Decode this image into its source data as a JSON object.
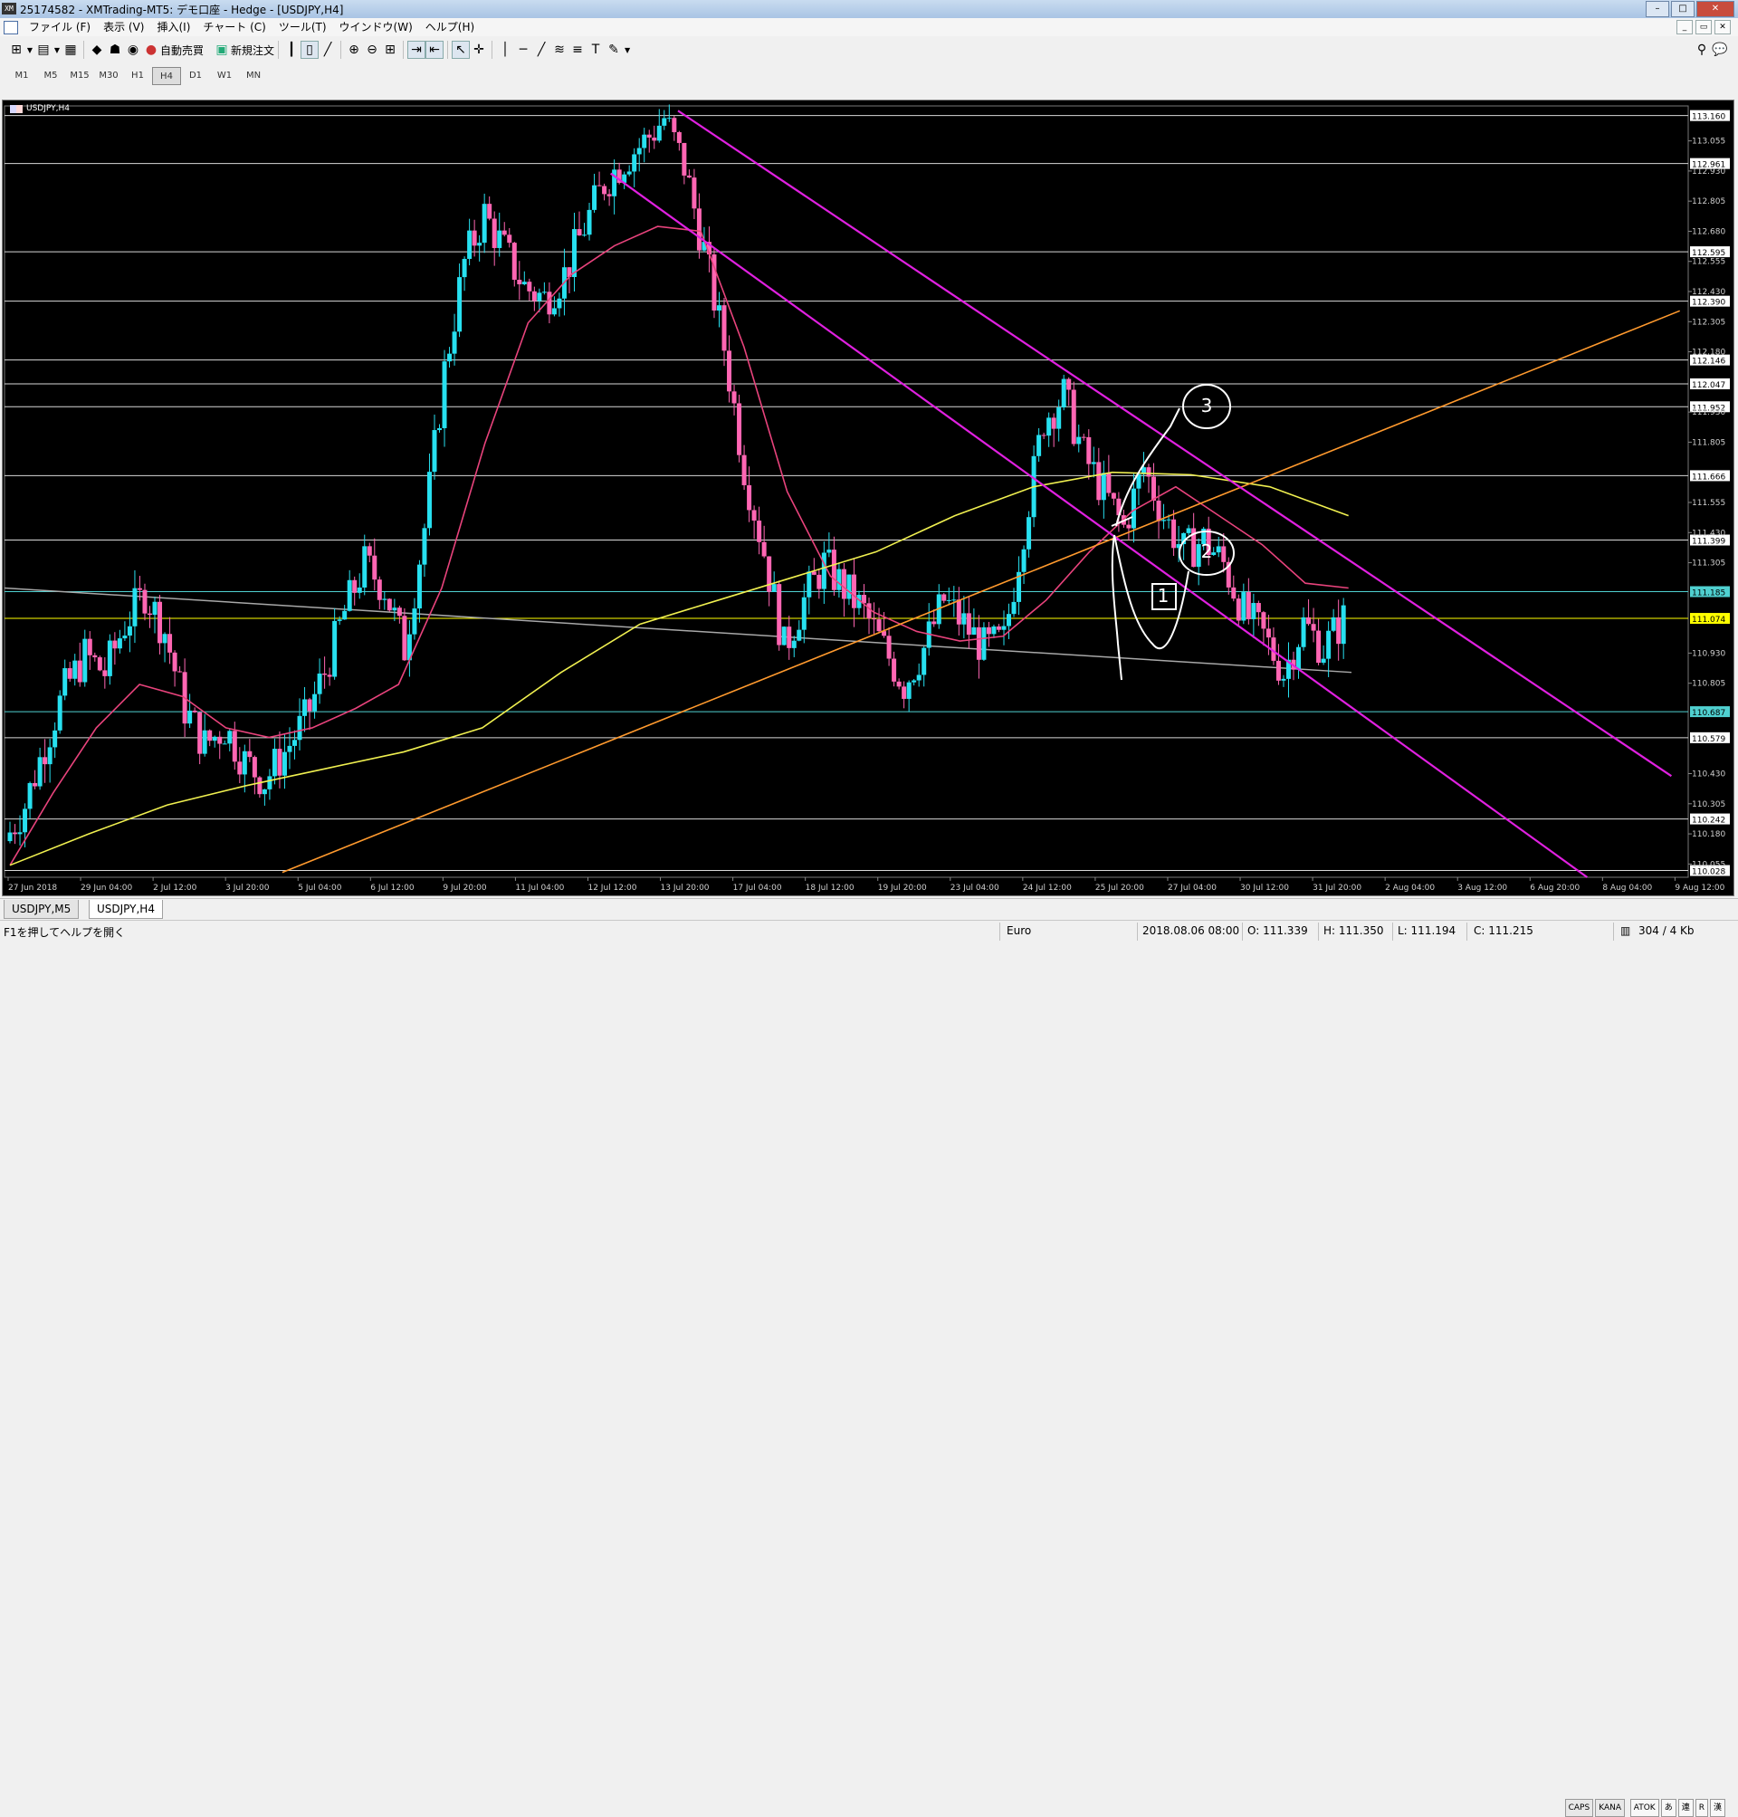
{
  "window": {
    "title": "25174582 - XMTrading-MT5: デモ口座 - Hedge - [USDJPY,H4]",
    "app_icon": "XM"
  },
  "menu": [
    "ファイル (F)",
    "表示 (V)",
    "挿入(I)",
    "チャート (C)",
    "ツール(T)",
    "ウインドウ(W)",
    "ヘルプ(H)"
  ],
  "toolbar": {
    "auto_trade_label": "自動売買",
    "new_order_label": "新規注文"
  },
  "timeframes": [
    "M1",
    "M5",
    "M15",
    "M30",
    "H1",
    "H4",
    "D1",
    "W1",
    "MN"
  ],
  "active_timeframe": "H4",
  "chart_label": "USDJPY,H4",
  "chart_data": {
    "type": "candlestick",
    "symbol": "USDJPY",
    "timeframe": "H4",
    "ylim": [
      110.0,
      113.2
    ],
    "y_ticks": [
      "113.055",
      "112.930",
      "112.805",
      "112.680",
      "112.555",
      "112.430",
      "112.305",
      "112.180",
      "111.930",
      "111.805",
      "111.555",
      "111.430",
      "111.305",
      "110.930",
      "110.805",
      "110.430",
      "110.305",
      "110.180",
      "110.055"
    ],
    "highlighted_levels": [
      {
        "value": 113.16,
        "label": "113.160"
      },
      {
        "value": 112.961,
        "label": "112.961"
      },
      {
        "value": 112.595,
        "label": "112.595"
      },
      {
        "value": 112.39,
        "label": "112.390"
      },
      {
        "value": 112.146,
        "label": "112.146"
      },
      {
        "value": 112.047,
        "label": "112.047"
      },
      {
        "value": 111.952,
        "label": "111.952"
      },
      {
        "value": 111.666,
        "label": "111.666"
      },
      {
        "value": 111.399,
        "label": "111.399"
      },
      {
        "value": 111.185,
        "label": "111.185",
        "color": "#4fd0d0"
      },
      {
        "value": 111.074,
        "label": "111.074",
        "color": "#ffff00"
      },
      {
        "value": 110.687,
        "label": "110.687",
        "color": "#4fd0d0"
      },
      {
        "value": 110.579,
        "label": "110.579"
      },
      {
        "value": 110.242,
        "label": "110.242"
      },
      {
        "value": 110.028,
        "label": "110.028"
      }
    ],
    "x_labels": [
      "27 Jun 2018",
      "29 Jun 04:00",
      "2 Jul 12:00",
      "3 Jul 20:00",
      "5 Jul 04:00",
      "6 Jul 12:00",
      "9 Jul 20:00",
      "11 Jul 04:00",
      "12 Jul 12:00",
      "13 Jul 20:00",
      "17 Jul 04:00",
      "18 Jul 12:00",
      "19 Jul 20:00",
      "23 Jul 04:00",
      "24 Jul 12:00",
      "25 Jul 20:00",
      "27 Jul 04:00",
      "30 Jul 12:00",
      "31 Jul 20:00",
      "2 Aug 04:00",
      "3 Aug 12:00",
      "6 Aug 20:00",
      "8 Aug 04:00",
      "9 Aug 12:00"
    ],
    "close_path": [
      110.15,
      110.3,
      110.55,
      110.78,
      110.92,
      110.85,
      111.05,
      111.18,
      111.02,
      110.7,
      110.55,
      110.62,
      110.48,
      110.4,
      110.52,
      110.65,
      110.85,
      111.1,
      111.3,
      111.2,
      110.95,
      111.45,
      112.1,
      112.55,
      112.75,
      112.6,
      112.45,
      112.4,
      112.5,
      112.7,
      112.88,
      112.98,
      113.05,
      113.15,
      112.95,
      112.6,
      112.2,
      111.7,
      111.35,
      110.95,
      111.15,
      111.3,
      111.2,
      111.1,
      110.95,
      110.8,
      110.95,
      111.15,
      111.05,
      110.95,
      110.98,
      111.45,
      111.9,
      112.0,
      111.75,
      111.6,
      111.45,
      111.7,
      111.5,
      111.35,
      111.4,
      111.3,
      111.1,
      111.0,
      110.85,
      111.05,
      110.95,
      111.07
    ],
    "ma_fast": [
      110.05,
      110.35,
      110.62,
      110.8,
      110.75,
      110.62,
      110.58,
      110.62,
      110.7,
      110.8,
      111.2,
      111.8,
      112.3,
      112.5,
      112.62,
      112.7,
      112.68,
      112.2,
      111.6,
      111.25,
      111.1,
      111.02,
      110.98,
      111.0,
      111.15,
      111.35,
      111.52,
      111.62,
      111.5,
      111.38,
      111.22,
      111.2
    ],
    "ma_slow": [
      110.05,
      110.18,
      110.3,
      110.38,
      110.45,
      110.52,
      110.62,
      110.85,
      111.05,
      111.15,
      111.25,
      111.35,
      111.5,
      111.62,
      111.68,
      111.67,
      111.62,
      111.5
    ],
    "trendline_orange": [
      [
        0.165,
        110.02
      ],
      [
        0.995,
        112.35
      ]
    ],
    "channel_upper": [
      [
        0.4,
        113.18
      ],
      [
        0.99,
        110.42
      ]
    ],
    "channel_lower": [
      [
        0.36,
        112.92
      ],
      [
        0.94,
        110.0
      ]
    ],
    "gray_line": [
      [
        0.0,
        111.2
      ],
      [
        0.8,
        110.85
      ]
    ],
    "annotations": [
      "1",
      "2",
      "3"
    ]
  },
  "tabs": [
    "USDJPY,M5",
    "USDJPY,H4"
  ],
  "active_tab": "USDJPY,H4",
  "status": {
    "help": "F1を押してヘルプを開く",
    "profile": "Euro",
    "datetime": "2018.08.06 08:00",
    "open": "O: 111.339",
    "high": "H: 111.350",
    "low": "L: 111.194",
    "close": "C: 111.215",
    "traffic": "304 / 4 Kb"
  },
  "ime": [
    "CAPS",
    "KANA",
    "ATOK",
    "あ",
    "連",
    "R",
    "漢"
  ]
}
